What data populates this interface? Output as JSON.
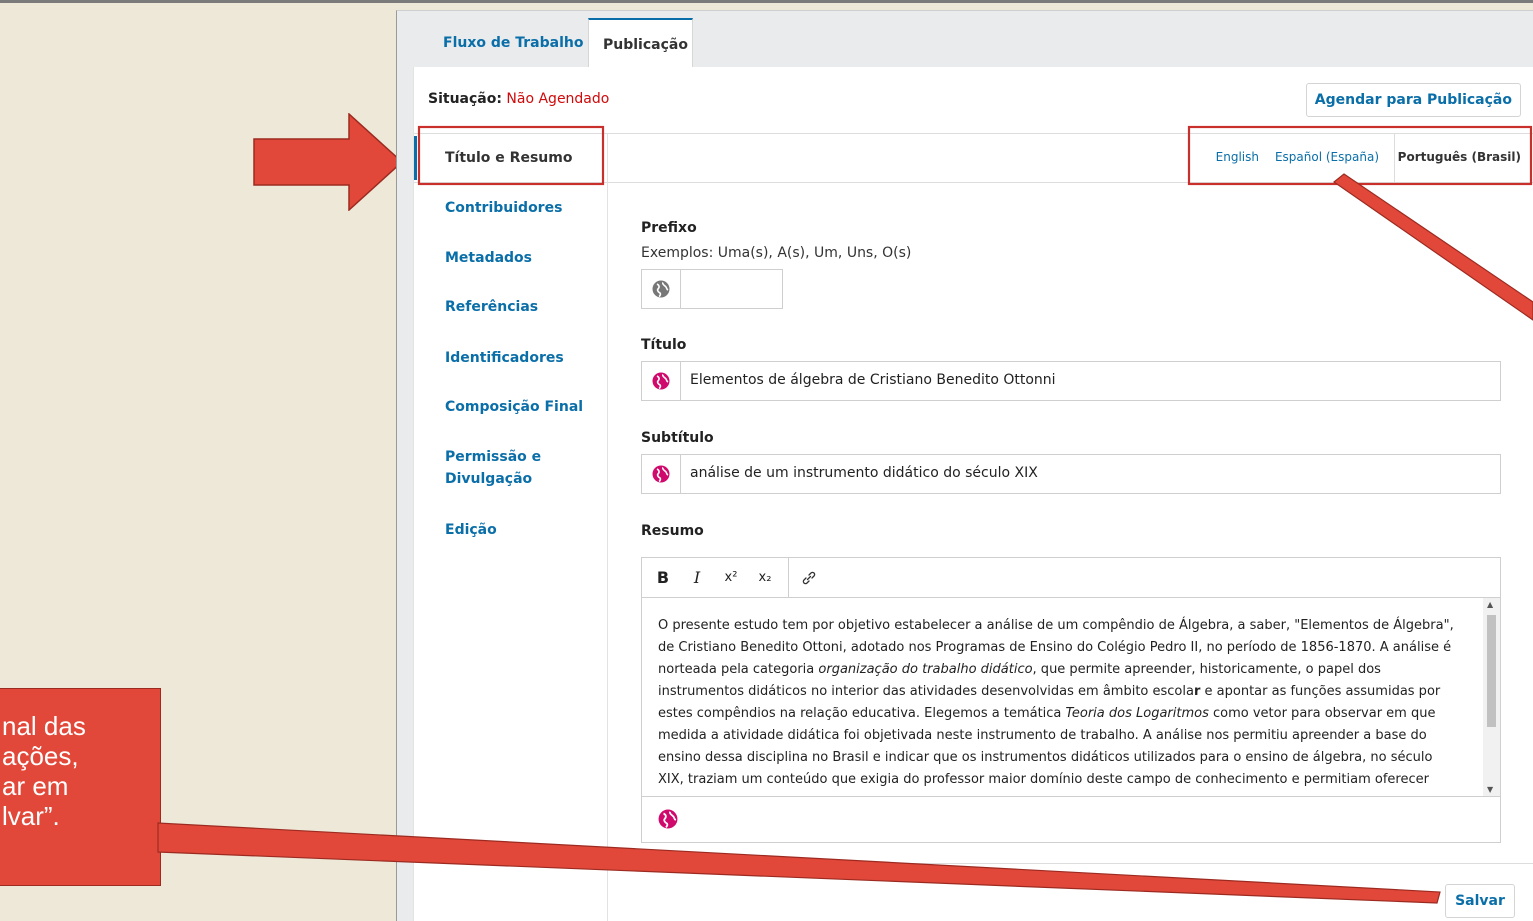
{
  "callout": {
    "lines": [
      "nal das",
      "ações,",
      "ar em",
      "lvar”."
    ]
  },
  "tabs": [
    {
      "label": "Fluxo de Trabalho"
    },
    {
      "label": "Publicação"
    }
  ],
  "status": {
    "label": "Situação:",
    "value": "Não Agendado"
  },
  "schedule_button": "Agendar para Publicação",
  "sidebar": {
    "items": [
      {
        "label": "Título e Resumo"
      },
      {
        "label": "Contribuidores"
      },
      {
        "label": "Metadados"
      },
      {
        "label": "Referências"
      },
      {
        "label": "Identificadores"
      },
      {
        "label": "Composição Final"
      },
      {
        "label_line1": "Permissão e",
        "label_line2": "Divulgação"
      },
      {
        "label": "Edição"
      }
    ]
  },
  "languages": [
    "English",
    "Español (España)",
    "Português (Brasil)"
  ],
  "form": {
    "prefix": {
      "label": "Prefixo",
      "hint": "Exemplos: Uma(s), A(s), Um, Uns, O(s)",
      "value": ""
    },
    "title": {
      "label": "Título",
      "value": "Elementos de álgebra de Cristiano Benedito Ottonni"
    },
    "subtitle": {
      "label": "Subtítulo",
      "value": "análise de um instrumento didático do século XIX"
    },
    "abstract": {
      "label": "Resumo",
      "toolbar": [
        "B",
        "I",
        "x²",
        "x₂",
        "link"
      ],
      "lines": [
        "O presente estudo tem por objetivo estabelecer a análise de um compêndio de Álgebra, a saber, \"Elementos de Álgebra\",",
        "de Cristiano Benedito Ottoni, adotado nos Programas de Ensino do Colégio Pedro II, no período de 1856-1870. A análise é",
        "norteada pela categoria ",
        "organização do trabalho didático",
        ", que permite apreender, historicamente, o papel dos",
        "instrumentos didáticos no interior das atividades desenvolvidas em âmbito escola",
        "r",
        " e apontar as funções assumidas por",
        "estes compêndios na relação educativa. Elegemos a temática ",
        "Teoria dos Logaritmos",
        " como vetor para observar em que",
        "medida a atividade didática foi objetivada neste instrumento de trabalho. A análise nos permitiu apreender a base do",
        "ensino dessa disciplina no Brasil e indicar que os instrumentos didáticos utilizados para o ensino de álgebra, no século",
        "XIX, traziam um conteúdo que exigia do professor maior domínio deste campo de conhecimento e permitiam oferecer"
      ]
    }
  },
  "save_button": "Salvar",
  "colors": {
    "link_blue": "#0a6ea8",
    "status_red": "#d00a0a",
    "globe_pink": "#d00a6c",
    "arrow_red": "#e2483a"
  }
}
